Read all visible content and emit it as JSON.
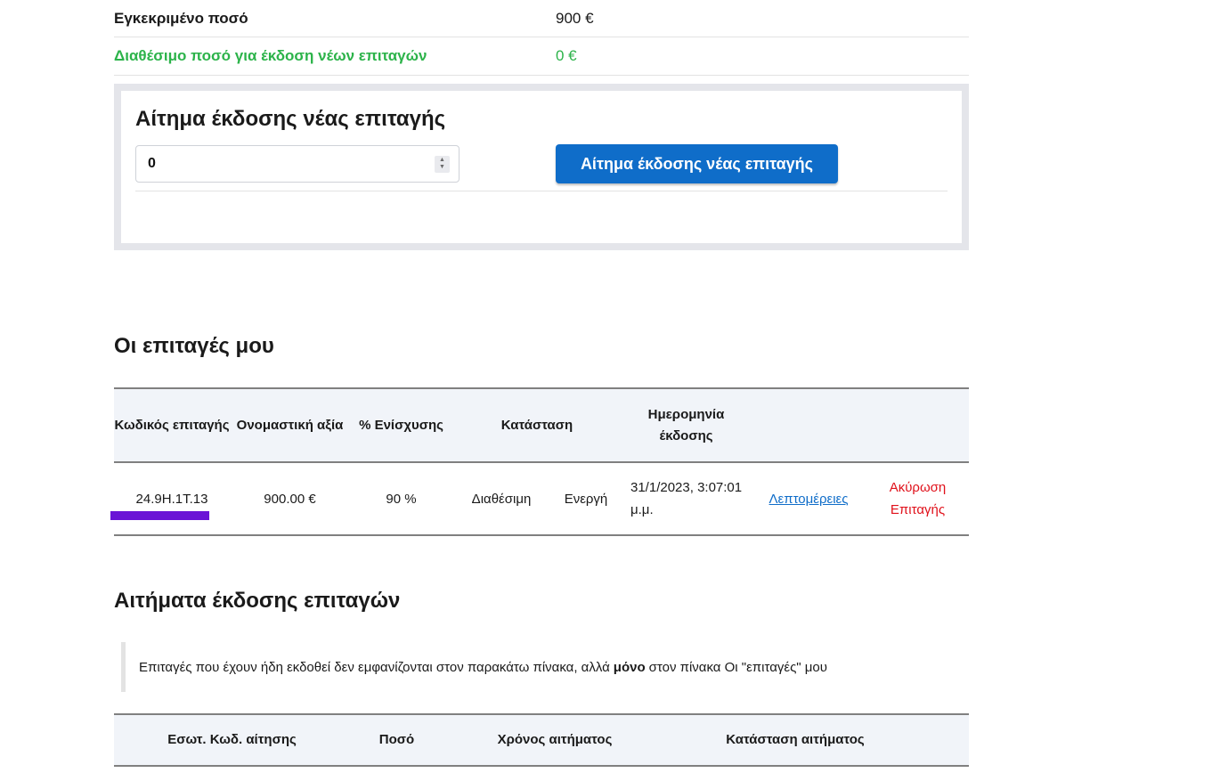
{
  "amounts": {
    "approved_label": "Εγκεκριμένο ποσό",
    "approved_value": "900 €",
    "available_label": "Διαθέσιμο ποσό για έκδοση νέων επιταγών",
    "available_value": "0 €"
  },
  "request_form": {
    "title": "Αίτημα έκδοσης νέας επιταγής",
    "amount_value": "0",
    "submit_label": "Αίτημα έκδοσης νέας επιταγής"
  },
  "my_checks": {
    "title": "Οι επιταγές μου",
    "headers": {
      "code": "Κωδικός επιταγής",
      "nominal": "Ονομαστική αξία",
      "percent": "% Ενίσχυσης",
      "status": "Κατάσταση",
      "date": "Ημερομηνία έκδοσης"
    },
    "rows": [
      {
        "code": "24.9H.1T.13",
        "nominal": "900.00 €",
        "percent": "90 %",
        "status_availability": "Διαθέσιμη",
        "status_state": "Ενεργή",
        "date": "31/1/2023, 3:07:01 μ.μ.",
        "details_label": "Λεπτομέρειες",
        "cancel_label": "Ακύρωση Επιταγής"
      }
    ]
  },
  "requests": {
    "title": "Αιτήματα έκδοσης επιταγών",
    "note_before": "Επιταγές που έχουν ήδη εκδοθεί δεν εμφανίζονται στον παρακάτω πίνακα, αλλά",
    "note_bold": "μόνο",
    "note_after": "στον πίνακα Οι \"επιταγές\" μου",
    "headers": {
      "internal_code": "Εσωτ. Κωδ. αίτησης",
      "amount": "Ποσό",
      "time": "Χρόνος αιτήματος",
      "status": "Κατάσταση αιτήματος"
    }
  },
  "colors": {
    "accent": "#0f6dc9",
    "available": "#2cb34a",
    "cancel": "#e0101a",
    "highlight_mark": "#6a14d6"
  }
}
